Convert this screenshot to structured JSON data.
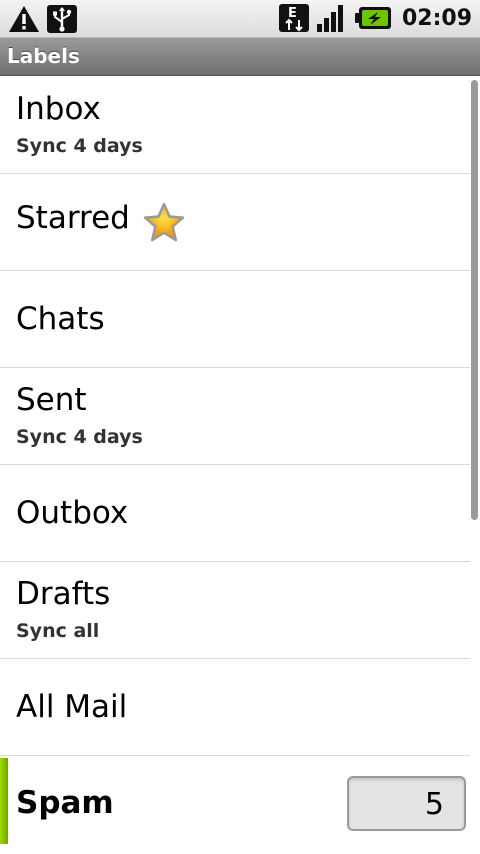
{
  "statusbar": {
    "time": "02:09",
    "network_type": "E",
    "icons": [
      "warning-icon",
      "usb-icon",
      "edge-data-icon",
      "signal-icon",
      "battery-charging-icon"
    ]
  },
  "titlebar": {
    "title": "Labels"
  },
  "labels": [
    {
      "name": "Inbox",
      "sync": "Sync 4 days"
    },
    {
      "name": "Starred",
      "icon": "star-icon"
    },
    {
      "name": "Chats"
    },
    {
      "name": "Sent",
      "sync": "Sync 4 days"
    },
    {
      "name": "Outbox"
    },
    {
      "name": "Drafts",
      "sync": "Sync all"
    },
    {
      "name": "All Mail"
    },
    {
      "name": "Spam",
      "unread_count": "5"
    }
  ],
  "colors": {
    "titlebar": "#7f7f7f",
    "unread_indicator": "#8cc800",
    "star": "#f6a800"
  }
}
